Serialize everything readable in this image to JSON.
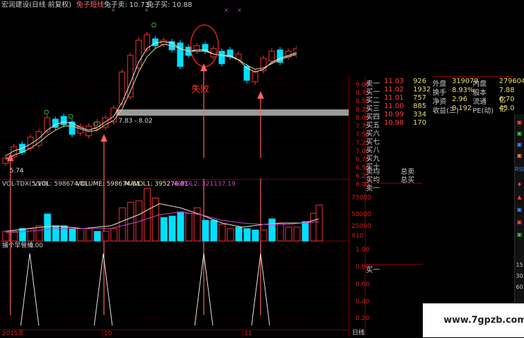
{
  "title_bar": {
    "stock_label": "宏润建设(日线 前复权)",
    "indicator1": "兔子短线",
    "indicator2": "兔子卖: 10.73",
    "indicator3": "兔子买: 10.88"
  },
  "annotations": {
    "fail_text": "失败",
    "range_label": "7.83 - 8.02",
    "low_label": "5.74"
  },
  "price_axis": [
    "9.00",
    "8.75",
    "8.50",
    "8.25",
    "8.00",
    "7.75",
    "7.50",
    "7.25",
    "7.00",
    "6.75",
    "6.50",
    "6.25",
    "6.00"
  ],
  "volume_panel": {
    "name": "VOL-TDX(5,10)",
    "vvol": "VVOL: 598674.81",
    "volume": "VOLUME: 598674.81",
    "mavol1": "MAVOL1: 395276.81",
    "mavol2": "MAVOL2: 321137.19",
    "axis": [
      "75000",
      "50000",
      "25000",
      "X10"
    ]
  },
  "indicator_panel": {
    "name": "捕个早餐线",
    "value": "0.00",
    "axis": [
      "1.00",
      "0.80",
      "0.60",
      "0.40",
      "0.20"
    ]
  },
  "date_labels": [
    "2015年",
    "10",
    "11"
  ],
  "period_tab": "日线",
  "watermark": "www.7gpzb.com",
  "order_book": {
    "sells": [
      {
        "label": "卖一",
        "price": "11.03",
        "vol": "926"
      },
      {
        "label": "买一",
        "price": "11.02",
        "vol": "1932"
      },
      {
        "label": "买二",
        "price": "11.01",
        "vol": "757"
      },
      {
        "label": "买三",
        "price": "11.00",
        "vol": "885"
      },
      {
        "label": "买四",
        "price": "10.99",
        "vol": "334"
      },
      {
        "label": "买五",
        "price": "10.98",
        "vol": "170"
      },
      {
        "label": "买六",
        "price": "",
        "vol": ""
      },
      {
        "label": "买七",
        "price": "",
        "vol": ""
      },
      {
        "label": "买八",
        "price": "",
        "vol": ""
      },
      {
        "label": "买九",
        "price": "",
        "vol": ""
      },
      {
        "label": "买十",
        "price": "",
        "vol": ""
      }
    ],
    "sell_avg": "卖均",
    "buy_avg": "买均",
    "total_sell": "总卖",
    "total_buy": "总买",
    "bottom1": "卖一",
    "bottom2": "买一"
  },
  "stats": [
    {
      "l1": "外盘",
      "v1": "319070",
      "l2": "内盘",
      "v2": "279604"
    },
    {
      "l1": "换手",
      "v1": "8.93%",
      "l2": "股本",
      "v2": "7.88亿"
    },
    {
      "l1": "净资",
      "v1": "2.96",
      "l2": "流通",
      "v2": "6.70亿"
    },
    {
      "l1": "收益(三)",
      "v1": "0.192",
      "l2": "PE(动)",
      "v2": "43.0"
    }
  ],
  "right_toolbar": [
    "RSI",
    "15",
    "30",
    "60"
  ],
  "colors": {
    "up": "#ff3030",
    "down": "#00e0ff",
    "ma_white": "#e8e8e8",
    "ma_yellow": "#e8d890",
    "magenta": "#d040d0",
    "axis_red": "#b01010",
    "gray_band": "#9a9a9a"
  }
}
